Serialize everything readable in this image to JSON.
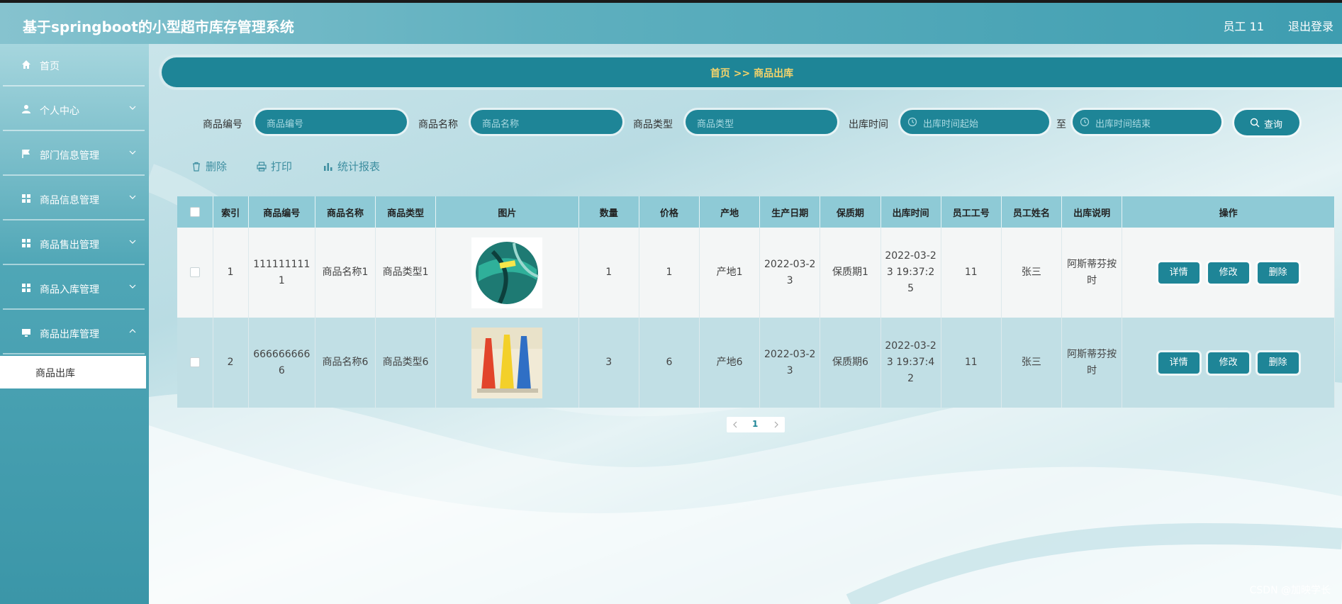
{
  "app": {
    "title": "基于springboot的小型超市库存管理系统",
    "user": "员工 11",
    "logout": "退出登录"
  },
  "sidebar": {
    "items": [
      {
        "label": "首页",
        "icon": "home-icon"
      },
      {
        "label": "个人中心",
        "icon": "user-icon"
      },
      {
        "label": "部门信息管理",
        "icon": "flag-icon"
      },
      {
        "label": "商品信息管理",
        "icon": "grid-icon"
      },
      {
        "label": "商品售出管理",
        "icon": "grid-icon"
      },
      {
        "label": "商品入库管理",
        "icon": "grid-icon"
      },
      {
        "label": "商品出库管理",
        "icon": "monitor-icon"
      }
    ],
    "active_sub": "商品出库"
  },
  "breadcrumb": "首页 >> 商品出库",
  "search": {
    "fields": [
      {
        "label": "商品编号",
        "placeholder": "商品编号"
      },
      {
        "label": "商品名称",
        "placeholder": "商品名称"
      },
      {
        "label": "商品类型",
        "placeholder": "商品类型"
      },
      {
        "label": "出库时间",
        "placeholder": "出库时间起始"
      }
    ],
    "to_label": "至",
    "end_placeholder": "出库时间结束",
    "query_label": "查询"
  },
  "actions": {
    "delete": "删除",
    "print": "打印",
    "report": "统计报表"
  },
  "table": {
    "headers": [
      "索引",
      "商品编号",
      "商品名称",
      "商品类型",
      "图片",
      "数量",
      "价格",
      "产地",
      "生产日期",
      "保质期",
      "出库时间",
      "员工工号",
      "员工姓名",
      "出库说明",
      "操作"
    ],
    "rows": [
      {
        "index": "1",
        "code": "1111111111",
        "name": "商品名称1",
        "type": "商品类型1",
        "image": "green-soccer-ball",
        "qty": "1",
        "price": "1",
        "origin": "产地1",
        "prod_date": "2022-03-23",
        "shelf": "保质期1",
        "out_time": "2022-03-23 19:37:25",
        "emp_no": "11",
        "emp_name": "张三",
        "note": "阿斯蒂芬按时"
      },
      {
        "index": "2",
        "code": "6666666666",
        "name": "商品名称6",
        "type": "商品类型6",
        "image": "training-cones",
        "qty": "3",
        "price": "6",
        "origin": "产地6",
        "prod_date": "2022-03-23",
        "shelf": "保质期6",
        "out_time": "2022-03-23 19:37:42",
        "emp_no": "11",
        "emp_name": "张三",
        "note": "阿斯蒂芬按时"
      }
    ],
    "op_labels": {
      "detail": "详情",
      "edit": "修改",
      "delete": "删除"
    }
  },
  "pagination": {
    "current": "1"
  },
  "watermark": "CSDN @加映学长",
  "colors": {
    "accent": "#1e8597",
    "breadcrumb_text": "#f3d36b",
    "header_bg": "#5fb0bf"
  }
}
